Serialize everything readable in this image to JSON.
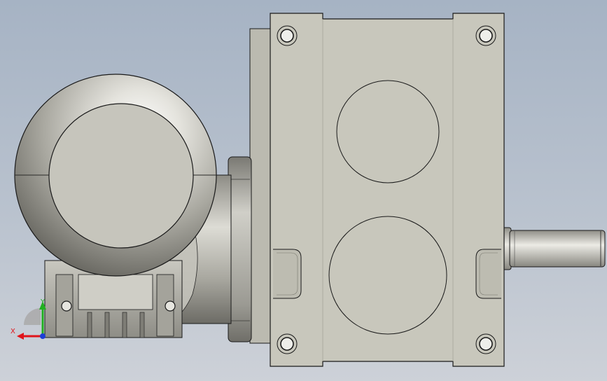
{
  "viewport": {
    "background_top": "#a6b3c4",
    "background_bottom": "#cdd1d8"
  },
  "model": {
    "gearbox_housing_color": "#c8c7bc",
    "motor_color": "#b4b3ab",
    "edge_color": "#1a1a1a"
  },
  "triad": {
    "x_label": "X",
    "y_label": "Y",
    "x_color": "#e0141a",
    "y_color": "#21b021",
    "z_color": "#1d3fd6"
  }
}
